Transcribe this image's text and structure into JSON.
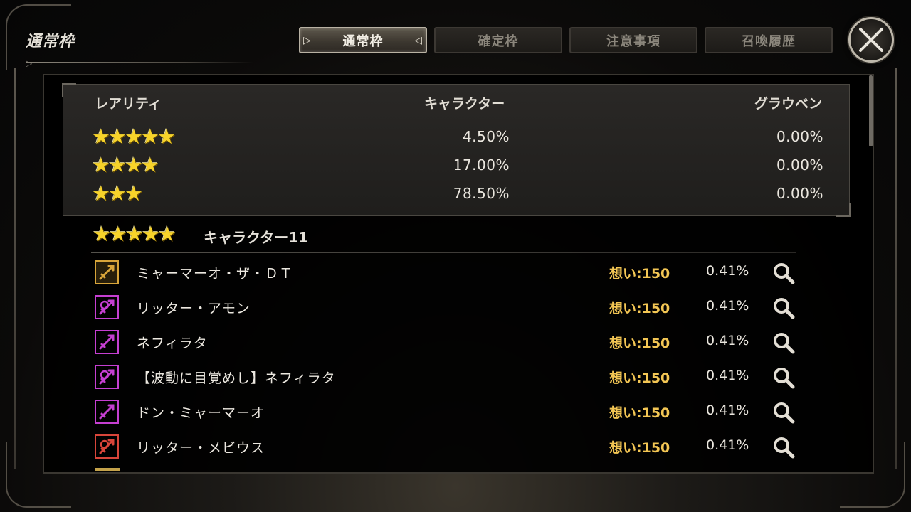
{
  "page_title": "通常枠",
  "tabs": [
    {
      "label": "通常枠",
      "active": true
    },
    {
      "label": "確定枠",
      "active": false
    },
    {
      "label": "注意事項",
      "active": false
    },
    {
      "label": "召喚履歴",
      "active": false
    }
  ],
  "close_icon": "close-x-icon",
  "rate_table": {
    "headers": {
      "rarity": "レアリティ",
      "character": "キャラクター",
      "grauben": "グラウベン"
    },
    "rows": [
      {
        "stars": 5,
        "character_rate": "4.50%",
        "grauben_rate": "0.00%"
      },
      {
        "stars": 4,
        "character_rate": "17.00%",
        "grauben_rate": "0.00%"
      },
      {
        "stars": 3,
        "character_rate": "78.50%",
        "grauben_rate": "0.00%"
      }
    ]
  },
  "section": {
    "stars": 5,
    "label": "キャラクター11"
  },
  "characters": [
    {
      "name": "ミャーマーオ・ザ・ＤＴ",
      "points": "想い:150",
      "rate": "0.41%",
      "color": "#d8a53a",
      "icon": "sword-emblem-icon"
    },
    {
      "name": "リッター・アモン",
      "points": "想い:150",
      "rate": "0.41%",
      "color": "#c53fd1",
      "icon": "crossed-weapon-icon"
    },
    {
      "name": "ネフィラタ",
      "points": "想い:150",
      "rate": "0.41%",
      "color": "#c53fd1",
      "icon": "sword-emblem-icon"
    },
    {
      "name": "【波動に目覚めし】ネフィラタ",
      "points": "想い:150",
      "rate": "0.41%",
      "color": "#c53fd1",
      "icon": "crossed-weapon-icon"
    },
    {
      "name": "ドン・ミャーマーオ",
      "points": "想い:150",
      "rate": "0.41%",
      "color": "#c53fd1",
      "icon": "sword-emblem-icon"
    },
    {
      "name": "リッター・メビウス",
      "points": "想い:150",
      "rate": "0.41%",
      "color": "#d8453a",
      "icon": "crossed-weapon-icon"
    }
  ],
  "colors": {
    "gold_text": "#f3c654",
    "star": "#f7d32a",
    "active_tab_border": "#b9b2a4"
  }
}
